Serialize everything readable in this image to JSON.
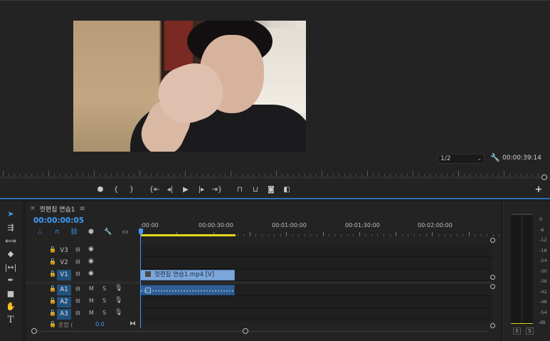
{
  "monitor": {
    "zoom_value": "1/2",
    "timecode": "00:00:39:14"
  },
  "icons": {
    "monitor_settings": "wrench-icon",
    "add": "plus-icon"
  },
  "transport": {
    "buttons": [
      "marker-icon",
      "mark-in-icon",
      "mark-out-icon",
      "go-to-in-icon",
      "step-back-icon",
      "play-icon",
      "step-forward-icon",
      "go-to-out-icon",
      "lift-icon",
      "extract-icon",
      "export-frame-icon",
      "compare-icon"
    ]
  },
  "tools": [
    "selection-tool-icon",
    "track-select-tool-icon",
    "ripple-edit-tool-icon",
    "razor-tool-icon",
    "slip-tool-icon",
    "pen-tool-icon",
    "rectangle-tool-icon",
    "hand-tool-icon",
    "type-tool-icon"
  ],
  "sequence": {
    "name": "컷편집 연습1",
    "timecode": "00:00:00:05"
  },
  "ruler": {
    "labels": [
      ":00:00",
      "00:00:30:00",
      "00:01:00:00",
      "00:01:30:00",
      "00:02:00:00"
    ]
  },
  "tracks": {
    "video": [
      {
        "name": "V3",
        "target": false
      },
      {
        "name": "V2",
        "target": false
      },
      {
        "name": "V1",
        "target": true
      }
    ],
    "audio": [
      {
        "name": "A1",
        "target": true,
        "m": "M",
        "s": "S"
      },
      {
        "name": "A2",
        "target": true,
        "m": "M",
        "s": "S"
      },
      {
        "name": "A3",
        "target": true,
        "m": "M",
        "s": "S"
      }
    ],
    "mix": {
      "label": "혼합 (",
      "value": "0.0"
    }
  },
  "clips": {
    "v1_label": "컷편집 연습1.mp4 [V]"
  },
  "meter": {
    "scale": [
      "0",
      "-6",
      "-12",
      "-18",
      "-24",
      "-30",
      "-36",
      "-42",
      "-48",
      "-54",
      "dB"
    ],
    "solo_left": "S",
    "solo_right": "S"
  },
  "colors": {
    "accent": "#3f9cf5",
    "video_clip": "#7ba6d9",
    "audio_clip": "#2f5c91",
    "work_area": "#e7d51e"
  }
}
